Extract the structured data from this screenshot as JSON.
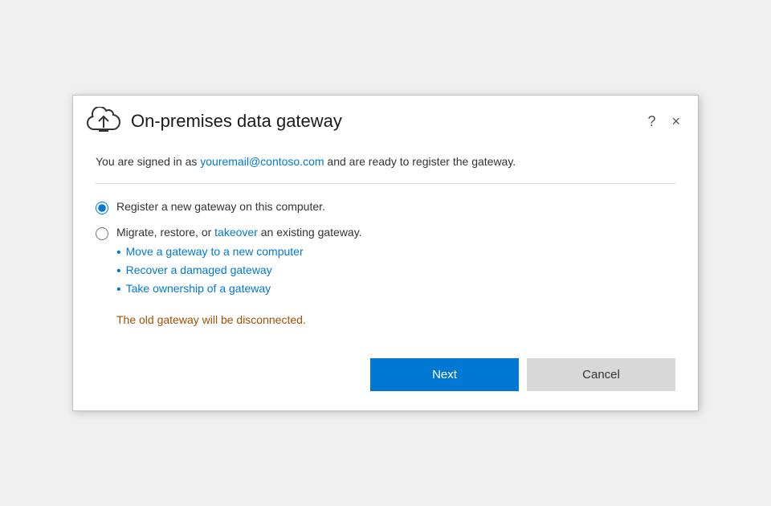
{
  "dialog": {
    "title": "On-premises data gateway",
    "help_label": "?",
    "close_label": "×"
  },
  "header": {
    "signed_in_prefix": "You are signed in as ",
    "email": "youremail@contoso.com",
    "signed_in_suffix": " and are ready to register the gateway."
  },
  "options": {
    "register_label": "Register a new gateway on this computer.",
    "migrate_label_prefix": "Migrate, restore, or ",
    "migrate_link": "takeover",
    "migrate_label_suffix": " an existing gateway.",
    "sub_items": [
      "Move a gateway to a new computer",
      "Recover a damaged gateway",
      "Take ownership of a gateway"
    ],
    "warning": "The old gateway will be disconnected."
  },
  "footer": {
    "next_label": "Next",
    "cancel_label": "Cancel"
  }
}
